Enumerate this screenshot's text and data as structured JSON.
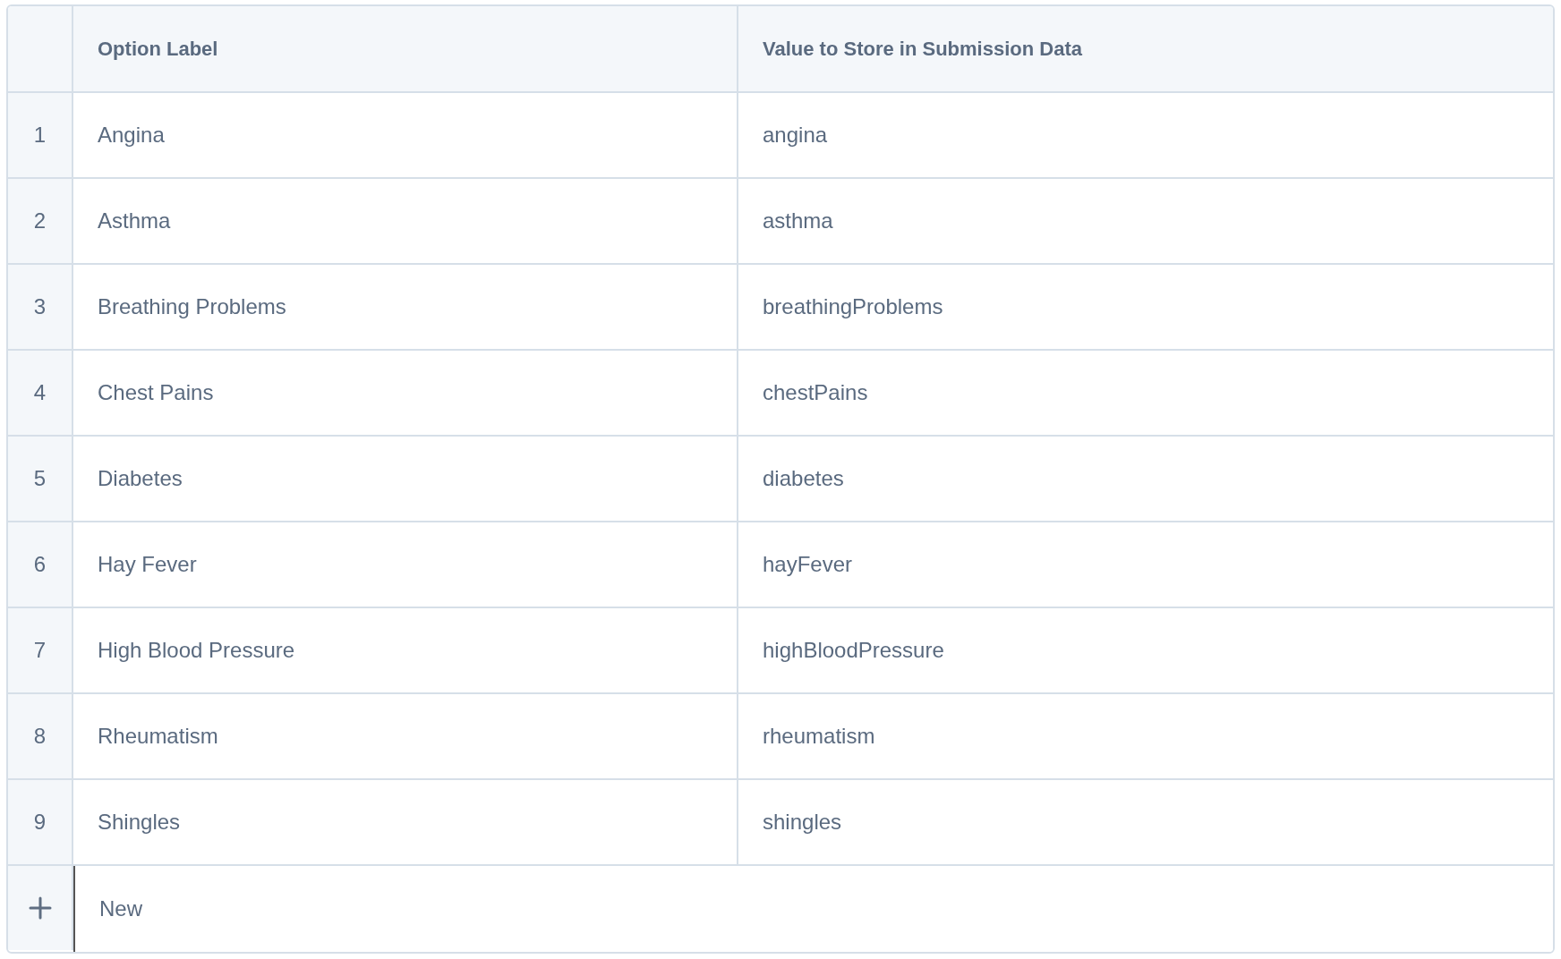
{
  "table": {
    "columns": [
      "Option Label",
      "Value to Store in Submission Data"
    ],
    "rows": [
      {
        "index": "1",
        "label": "Angina",
        "value": "angina"
      },
      {
        "index": "2",
        "label": "Asthma",
        "value": "asthma"
      },
      {
        "index": "3",
        "label": "Breathing Problems",
        "value": "breathingProblems"
      },
      {
        "index": "4",
        "label": "Chest Pains",
        "value": "chestPains"
      },
      {
        "index": "5",
        "label": "Diabetes",
        "value": "diabetes"
      },
      {
        "index": "6",
        "label": "Hay Fever",
        "value": "hayFever"
      },
      {
        "index": "7",
        "label": "High Blood Pressure",
        "value": "highBloodPressure"
      },
      {
        "index": "8",
        "label": "Rheumatism",
        "value": "rheumatism"
      },
      {
        "index": "9",
        "label": "Shingles",
        "value": "shingles"
      }
    ],
    "add_row": {
      "label": "New"
    }
  }
}
